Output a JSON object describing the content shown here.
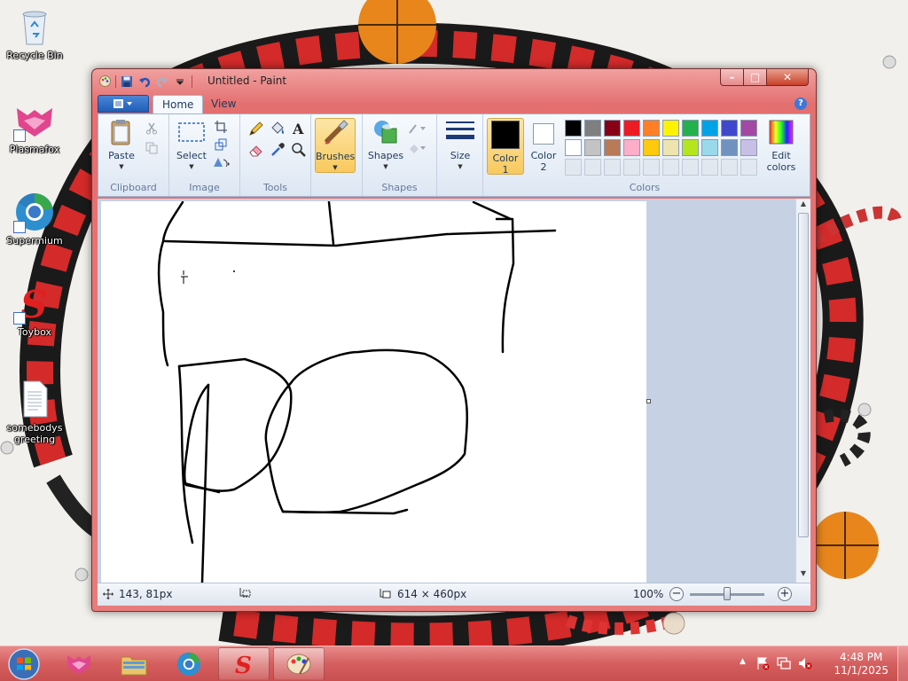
{
  "desktop": {
    "icons": [
      {
        "label": "Recycle Bin",
        "icon": "recycle-bin-icon"
      },
      {
        "label": "Plasmafox",
        "icon": "plasmafox-icon"
      },
      {
        "label": "Supermium",
        "icon": "supermium-icon"
      },
      {
        "label": "Toybox",
        "icon": "toybox-icon"
      },
      {
        "label": "somebodys greeting",
        "icon": "text-file-icon"
      }
    ]
  },
  "window": {
    "title": "Untitled - Paint",
    "controls": {
      "minimize": "–",
      "maximize": "□",
      "close": "✕"
    }
  },
  "ribbon": {
    "tabs": [
      "Home",
      "View"
    ],
    "active_tab": "Home",
    "groups": {
      "clipboard": {
        "label": "Clipboard",
        "paste": "Paste"
      },
      "image": {
        "label": "Image",
        "select": "Select"
      },
      "tools": {
        "label": "Tools"
      },
      "brushes": {
        "label": "Brushes"
      },
      "shapes": {
        "label": "Shapes",
        "button": "Shapes"
      },
      "size": {
        "label": "Size"
      },
      "colors": {
        "label": "Colors",
        "color1": "Color",
        "color1_num": "1",
        "color2": "Color",
        "color2_num": "2",
        "edit_colors_1": "Edit",
        "edit_colors_2": "colors",
        "color1_value": "#000000",
        "color2_value": "#ffffff",
        "palette_row1": [
          "#000000",
          "#7f7f7f",
          "#880015",
          "#ed1c24",
          "#ff7f27",
          "#fff200",
          "#22b14c",
          "#00a2e8",
          "#3f48cc",
          "#a349a4"
        ],
        "palette_row2": [
          "#ffffff",
          "#c3c3c3",
          "#b97a57",
          "#ffaec9",
          "#ffc90e",
          "#efe4b0",
          "#b5e61d",
          "#99d9ea",
          "#7092be",
          "#c8bfe7"
        ]
      }
    }
  },
  "statusbar": {
    "cursor_position": "143, 81px",
    "selection_size": "",
    "canvas_size": "614 × 460px",
    "zoom": "100%",
    "zoom_level": 0.5
  },
  "taskbar": {
    "time": "4:48 PM",
    "date": "11/1/2025",
    "buttons": [
      "plasmafox",
      "file-explorer",
      "supermium",
      "toybox",
      "paint"
    ]
  }
}
